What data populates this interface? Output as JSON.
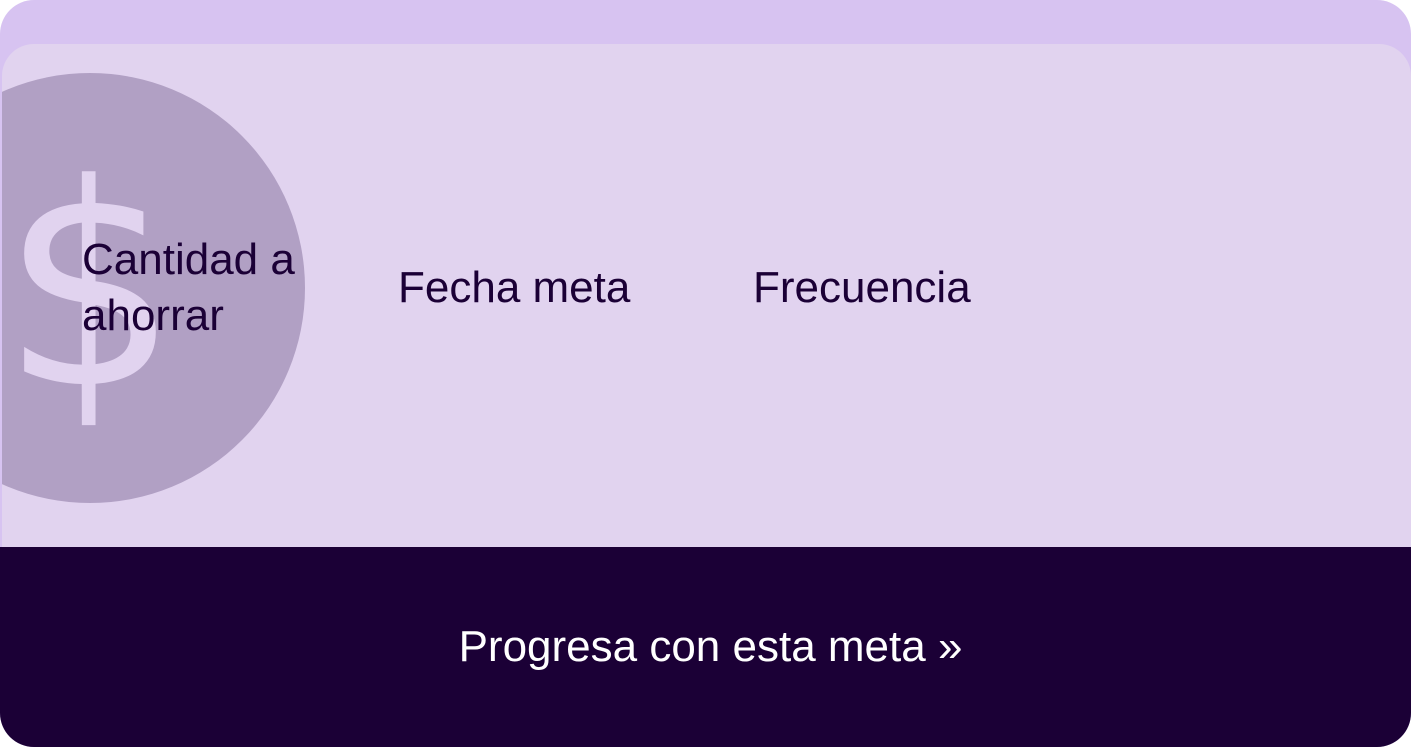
{
  "goal_card": {
    "icon": "dollar-coin-icon",
    "icon_glyph": "$",
    "fields": {
      "amount_label": "Cantidad a ahorrar",
      "date_label": "Fecha meta",
      "frequency_label": "Frecuencia"
    },
    "cta_label": "Progresa con esta meta »"
  },
  "colors": {
    "card_top": "#d7c3f1",
    "panel_background": "#e1d3ef",
    "coin": "#b1a0c4",
    "text_dark": "#1b0036",
    "cta_background": "#1b0036",
    "cta_text": "#ffffff"
  }
}
